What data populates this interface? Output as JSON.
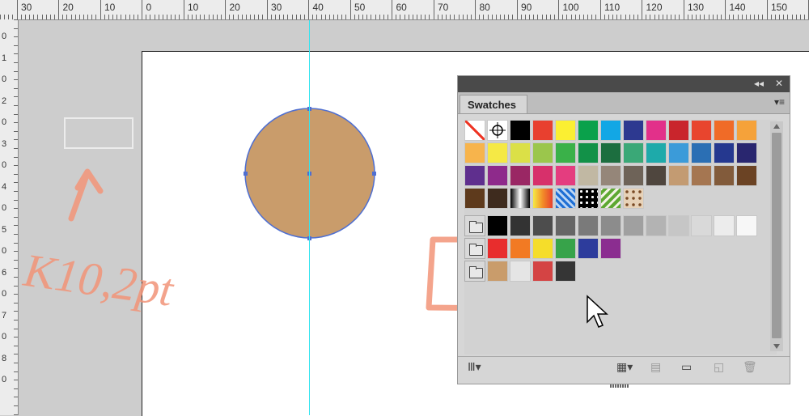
{
  "ruler": {
    "top_labels": [
      "30",
      "20",
      "10",
      "0",
      "10",
      "20",
      "30",
      "40",
      "50",
      "60",
      "70",
      "80",
      "90",
      "100",
      "110",
      "120",
      "130",
      "140",
      "150"
    ],
    "left_labels": [
      "0",
      "1",
      "0",
      "2",
      "0",
      "3",
      "0",
      "4",
      "0",
      "5",
      "0",
      "6",
      "0",
      "7",
      "0",
      "8",
      "0"
    ]
  },
  "canvas": {
    "circle_fill": "#c99c6b",
    "circle_stroke": "#4f6fd1",
    "guide_color": "#31e4f0",
    "handwritten_note": "K10,2pt"
  },
  "panel": {
    "collapse_label": "◂◂",
    "close_label": "✕",
    "tab_label": "Swatches",
    "menu_label": "▾≡",
    "rows": [
      [
        "none",
        "registration",
        "#000000",
        "#e8402f",
        "#fbef32",
        "#0aa14b",
        "#12a7e5",
        "#2d3990",
        "#e2308a",
        "#c9252c",
        "#e8452e",
        "#f06b27",
        "#f5a23a"
      ],
      [
        "#f7b44c",
        "#f5e945",
        "#dbe047",
        "#9bc64c",
        "#3ab149",
        "#129148",
        "#1c6e3f",
        "#3aa877",
        "#1eaaaa",
        "#3b9bd9",
        "#2b6fb4",
        "#25388f",
        "#29266f"
      ],
      [
        "#5f2f8e",
        "#8e2a8b",
        "#9a2764",
        "#d7306b",
        "#e43d7f",
        "#c1b8a3",
        "#958679",
        "#6e6358",
        "#4f463e",
        "#c39b72",
        "#a57651",
        "#825b3b",
        "#6b4324"
      ],
      [
        "#5e3a1c",
        "#3e2b1e",
        "gradient-bw",
        "gradient-orange",
        "pattern-blue",
        "pattern-dots",
        "pattern-leaf",
        "pattern-paisley"
      ],
      [
        "folder",
        "#000000",
        "#333333",
        "#4d4d4d",
        "#666666",
        "#7a7a7a",
        "#8c8c8c",
        "#a0a0a0",
        "#b3b3b3",
        "#c6c6c6",
        "#d9d9d9",
        "#ececec",
        "#f7f7f7"
      ],
      [
        "folder",
        "#e82d2d",
        "#f27a23",
        "#f5dd2a",
        "#37a34a",
        "#2d3c9c",
        "#8b2d90"
      ],
      [
        "folder",
        "#c99c6b",
        "#e5e5e5",
        "#d44444",
        "#353535"
      ]
    ],
    "bottom_icons": [
      "library-icon",
      "swatch-kind-icon",
      "swatch-options-icon",
      "new-group-icon",
      "new-swatch-icon",
      "delete-icon"
    ]
  }
}
